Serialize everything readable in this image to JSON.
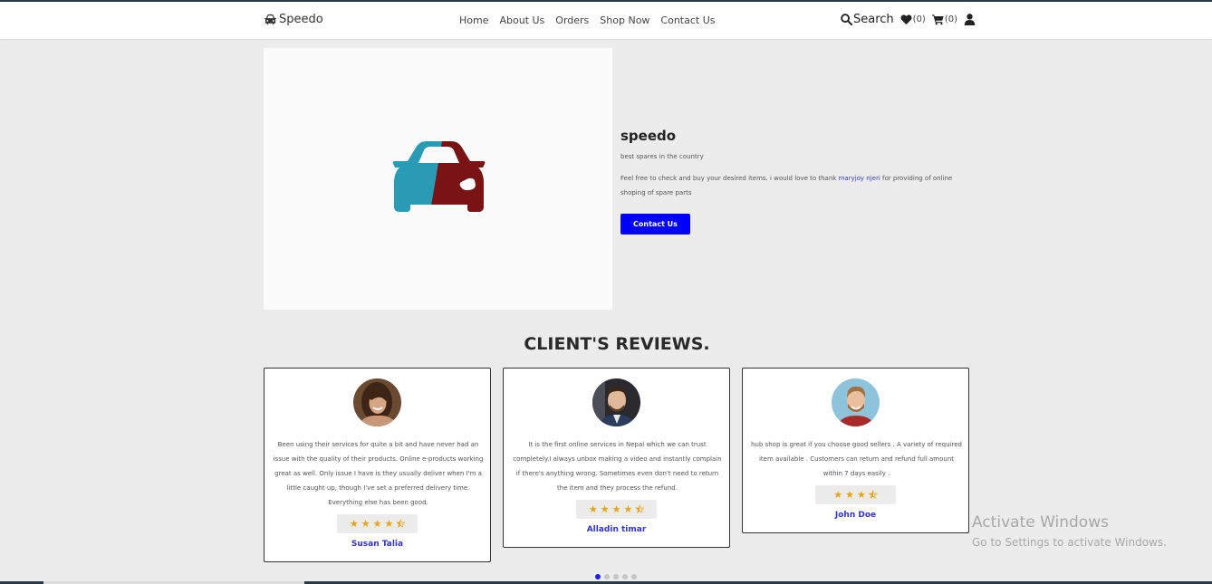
{
  "nav": {
    "brand": "Speedo",
    "links": [
      "Home",
      "About Us",
      "Orders",
      "Shop Now",
      "Contact Us"
    ],
    "search_label": "Search",
    "wishlist_count": "(0)",
    "cart_count": "(0)"
  },
  "hero": {
    "title": "speedo",
    "tagline": "best spares in the country",
    "desc_before": "Feel free to check and buy your desired items. i would love to thank ",
    "desc_link": "maryjoy njeri",
    "desc_after": " for providing of online shoping of spare parts",
    "button": "Contact Us",
    "logo_colors": {
      "left": "#2a9bb5",
      "right": "#7a1414"
    }
  },
  "reviews": {
    "title": "CLIENT'S REVIEWS.",
    "items": [
      {
        "text": "Been using their services for quite a bit and have never had an issue with the quality of their products. Online e-products working great as well. Only issue I have is they usually deliver when I'm a little caught up, though I've set a preferred delivery time. Everything else has been good.",
        "rating": 4.5,
        "name": "Susan Talia"
      },
      {
        "text": "It is the first online services in Nepal which we can trust completely.I always unbox making a video and instantly complain if there's anything wrong. Sometimes even don't need to return the item and they process the refund.",
        "rating": 4.5,
        "name": "Alladin timar"
      },
      {
        "text": "hub shop is great if you choose good sellers . A variety of required item available . Customers can return and refund full amount within 7 days easily .",
        "rating": 3.5,
        "name": "John Doe"
      }
    ],
    "carousel_dots": 5,
    "active_dot": 0
  },
  "watermark": {
    "line1": "Activate Windows",
    "line2": "Go to Settings to activate Windows."
  },
  "colors": {
    "accent": "#0000ff",
    "star": "#f0a10b",
    "reviewer_name": "#3434c6"
  }
}
